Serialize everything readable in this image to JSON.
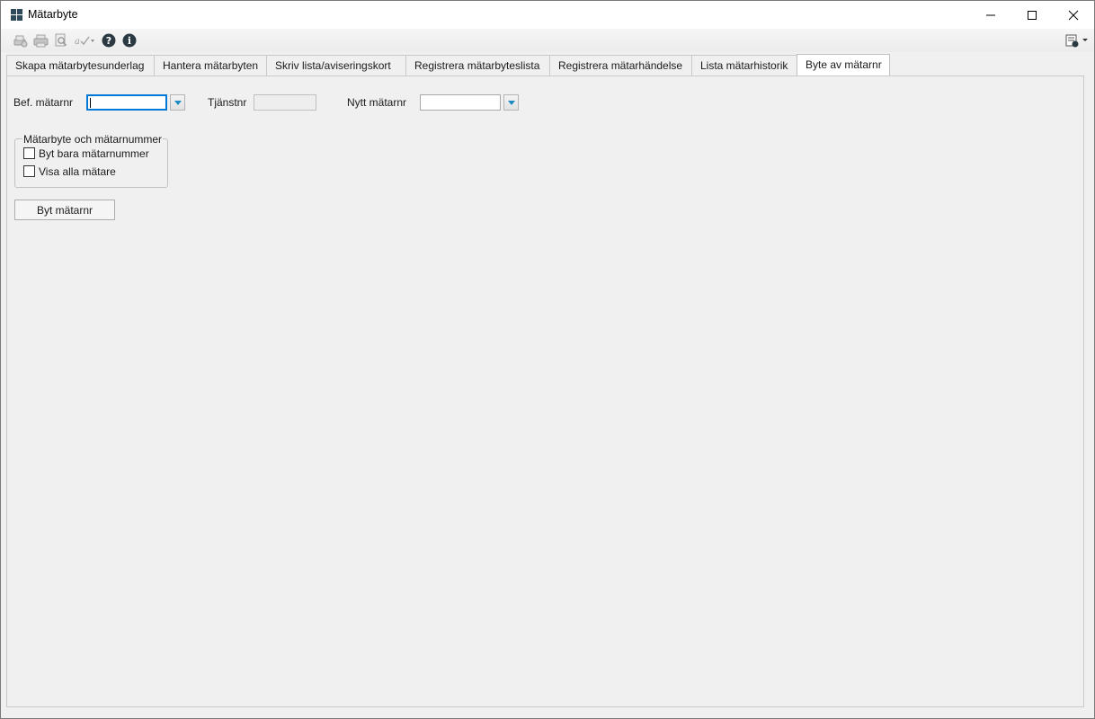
{
  "window": {
    "title": "Mätarbyte"
  },
  "tabs": [
    {
      "label": "Skapa mätarbytesunderlag"
    },
    {
      "label": "Hantera mätarbyten"
    },
    {
      "label": "Skriv lista/aviseringskort"
    },
    {
      "label": "Registrera mätarbyteslista"
    },
    {
      "label": "Registrera mätarhändelse"
    },
    {
      "label": "Lista mätarhistorik"
    },
    {
      "label": "Byte av mätarnr"
    }
  ],
  "form": {
    "bef_label": "Bef. mätarnr",
    "bef_value": "",
    "tjanst_label": "Tjänstnr",
    "tjanst_value": "",
    "nytt_label": "Nytt mätarnr",
    "nytt_value": ""
  },
  "group": {
    "legend": "Mätarbyte och mätarnummer",
    "options": [
      {
        "label": "Byt bara mätarnummer",
        "checked": false
      },
      {
        "label": "Visa alla mätare",
        "checked": false
      }
    ]
  },
  "actions": {
    "byt_label": "Byt mätarnr"
  },
  "colors": {
    "accent": "#0078d7",
    "help_icon": "#2b3a42",
    "dropdown_arrow": "#1e8bc3"
  }
}
